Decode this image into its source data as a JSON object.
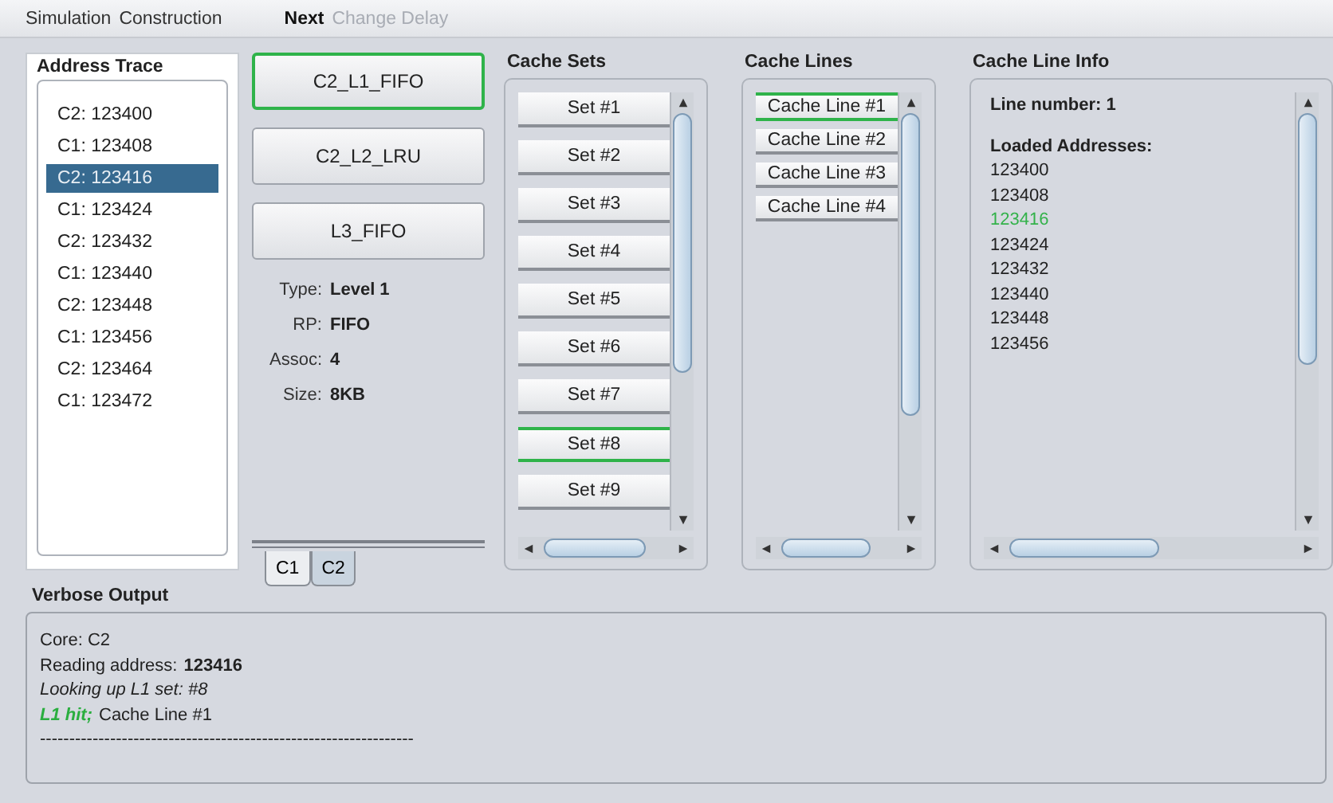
{
  "menu": [
    {
      "label": "Simulation",
      "kind": "menu",
      "disabled": false
    },
    {
      "label": "Construction",
      "kind": "menu",
      "disabled": false
    },
    {
      "label": "Next",
      "kind": "action",
      "disabled": false
    },
    {
      "label": "Change Delay",
      "kind": "action",
      "disabled": true
    }
  ],
  "address_trace": {
    "title": "Address Trace",
    "items": [
      {
        "text": "C2: 123400",
        "selected": false
      },
      {
        "text": "C1: 123408",
        "selected": false
      },
      {
        "text": "C2: 123416",
        "selected": true
      },
      {
        "text": "C1: 123424",
        "selected": false
      },
      {
        "text": "C2: 123432",
        "selected": false
      },
      {
        "text": "C1: 123440",
        "selected": false
      },
      {
        "text": "C2: 123448",
        "selected": false
      },
      {
        "text": "C1: 123456",
        "selected": false
      },
      {
        "text": "C2: 123464",
        "selected": false
      },
      {
        "text": "C1: 123472",
        "selected": false
      }
    ]
  },
  "caches": [
    {
      "label": "C2_L1_FIFO",
      "selected": true
    },
    {
      "label": "C2_L2_LRU",
      "selected": false
    },
    {
      "label": "L3_FIFO",
      "selected": false
    }
  ],
  "cache_props": [
    {
      "label": "Type:",
      "value": "Level 1"
    },
    {
      "label": "RP:",
      "value": "FIFO"
    },
    {
      "label": "Assoc:",
      "value": "4"
    },
    {
      "label": "Size:",
      "value": "8KB"
    }
  ],
  "core_tabs": [
    {
      "label": "C1",
      "selected": false
    },
    {
      "label": "C2",
      "selected": true
    }
  ],
  "cache_sets": {
    "title": "Cache Sets",
    "items": [
      {
        "label": "Set #1",
        "selected": false
      },
      {
        "label": "Set #2",
        "selected": false
      },
      {
        "label": "Set #3",
        "selected": false
      },
      {
        "label": "Set #4",
        "selected": false
      },
      {
        "label": "Set #5",
        "selected": false
      },
      {
        "label": "Set #6",
        "selected": false
      },
      {
        "label": "Set #7",
        "selected": false
      },
      {
        "label": "Set #8",
        "selected": true
      },
      {
        "label": "Set #9",
        "selected": false
      }
    ]
  },
  "cache_lines": {
    "title": "Cache Lines",
    "items": [
      {
        "label": "Cache Line #1",
        "selected": true
      },
      {
        "label": "Cache Line #2",
        "selected": false
      },
      {
        "label": "Cache Line #3",
        "selected": false
      },
      {
        "label": "Cache Line #4",
        "selected": false
      }
    ]
  },
  "cache_line_info": {
    "title": "Cache Line Info",
    "line_number": "Line number: 1",
    "loaded_heading": "Loaded Addresses:",
    "addresses": [
      {
        "text": "123400",
        "highlighted": false
      },
      {
        "text": "123408",
        "highlighted": false
      },
      {
        "text": "123416",
        "highlighted": true
      },
      {
        "text": "123424",
        "highlighted": false
      },
      {
        "text": "123432",
        "highlighted": false
      },
      {
        "text": "123440",
        "highlighted": false
      },
      {
        "text": "123448",
        "highlighted": false
      },
      {
        "text": "123456",
        "highlighted": false
      }
    ]
  },
  "verbose_output": {
    "title": "Verbose Output",
    "lines": [
      {
        "parts": [
          {
            "text": "Core: C2",
            "kind": "plain"
          }
        ]
      },
      {
        "parts": [
          {
            "text": "Reading address:",
            "kind": "plain"
          },
          {
            "text": "123416",
            "kind": "bold"
          }
        ]
      },
      {
        "parts": [
          {
            "text": "Looking up L1 set: #8",
            "kind": "italic"
          }
        ]
      },
      {
        "parts": [
          {
            "text": "L1 hit;",
            "kind": "hit"
          },
          {
            "text": "Cache Line #1",
            "kind": "plain"
          }
        ]
      },
      {
        "parts": [
          {
            "text": "----------------------------------------------------------------",
            "kind": "plain"
          }
        ]
      }
    ]
  }
}
